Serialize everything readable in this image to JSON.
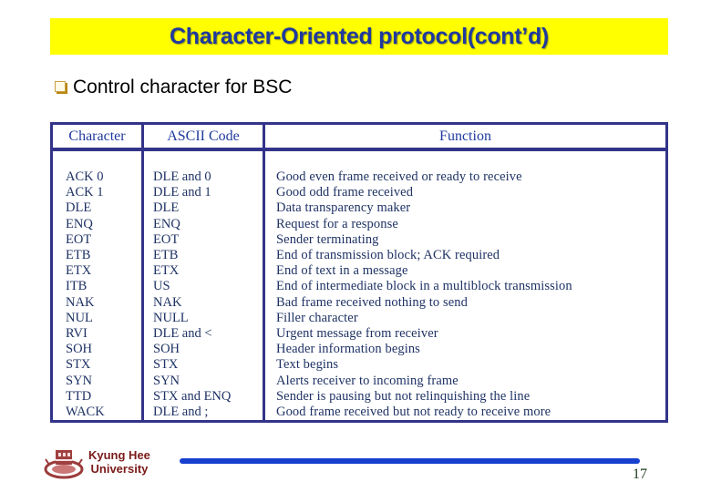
{
  "title": "Character-Oriented protocol(cont’d)",
  "bullet": {
    "icon": "hollow-square-bullet-icon",
    "text": "Control character for BSC"
  },
  "table": {
    "headers": [
      "Character",
      "ASCII Code",
      "Function"
    ],
    "rows": [
      {
        "character": "ACK 0",
        "ascii": "DLE and 0",
        "function": "Good even frame received or ready to receive"
      },
      {
        "character": "ACK 1",
        "ascii": "DLE and 1",
        "function": "Good odd frame received"
      },
      {
        "character": "DLE",
        "ascii": "DLE",
        "function": "Data transparency maker"
      },
      {
        "character": "ENQ",
        "ascii": "ENQ",
        "function": "Request for a response"
      },
      {
        "character": "EOT",
        "ascii": "EOT",
        "function": "Sender terminating"
      },
      {
        "character": "ETB",
        "ascii": "ETB",
        "function": "End of transmission block; ACK required"
      },
      {
        "character": "ETX",
        "ascii": "ETX",
        "function": "End of text in a message"
      },
      {
        "character": "ITB",
        "ascii": "US",
        "function": "End of intermediate block in a multiblock transmission"
      },
      {
        "character": "NAK",
        "ascii": "NAK",
        "function": "Bad frame received nothing to send"
      },
      {
        "character": "NUL",
        "ascii": "NULL",
        "function": "Filler character"
      },
      {
        "character": "RVI",
        "ascii": "DLE and <",
        "function": "Urgent message from receiver"
      },
      {
        "character": "SOH",
        "ascii": "SOH",
        "function": "Header information begins"
      },
      {
        "character": "STX",
        "ascii": "STX",
        "function": "Text begins"
      },
      {
        "character": "SYN",
        "ascii": "SYN",
        "function": "Alerts receiver to incoming frame"
      },
      {
        "character": "TTD",
        "ascii": "STX and ENQ",
        "function": "Sender is pausing but not relinquishing the line"
      },
      {
        "character": "WACK",
        "ascii": "DLE and ;",
        "function": "Good frame received but not ready to receive more"
      }
    ]
  },
  "footer": {
    "logo_icon": "university-seal-icon",
    "university_line1": "Kyung Hee",
    "university_line2": "University",
    "page_number": "17"
  },
  "colors": {
    "title_bg": "#ffff00",
    "title_text": "#1f3a9e",
    "table_border": "#33338a",
    "table_text": "#1e3264",
    "footer_line": "#1740cf",
    "university_text": "#7a1a1a"
  }
}
